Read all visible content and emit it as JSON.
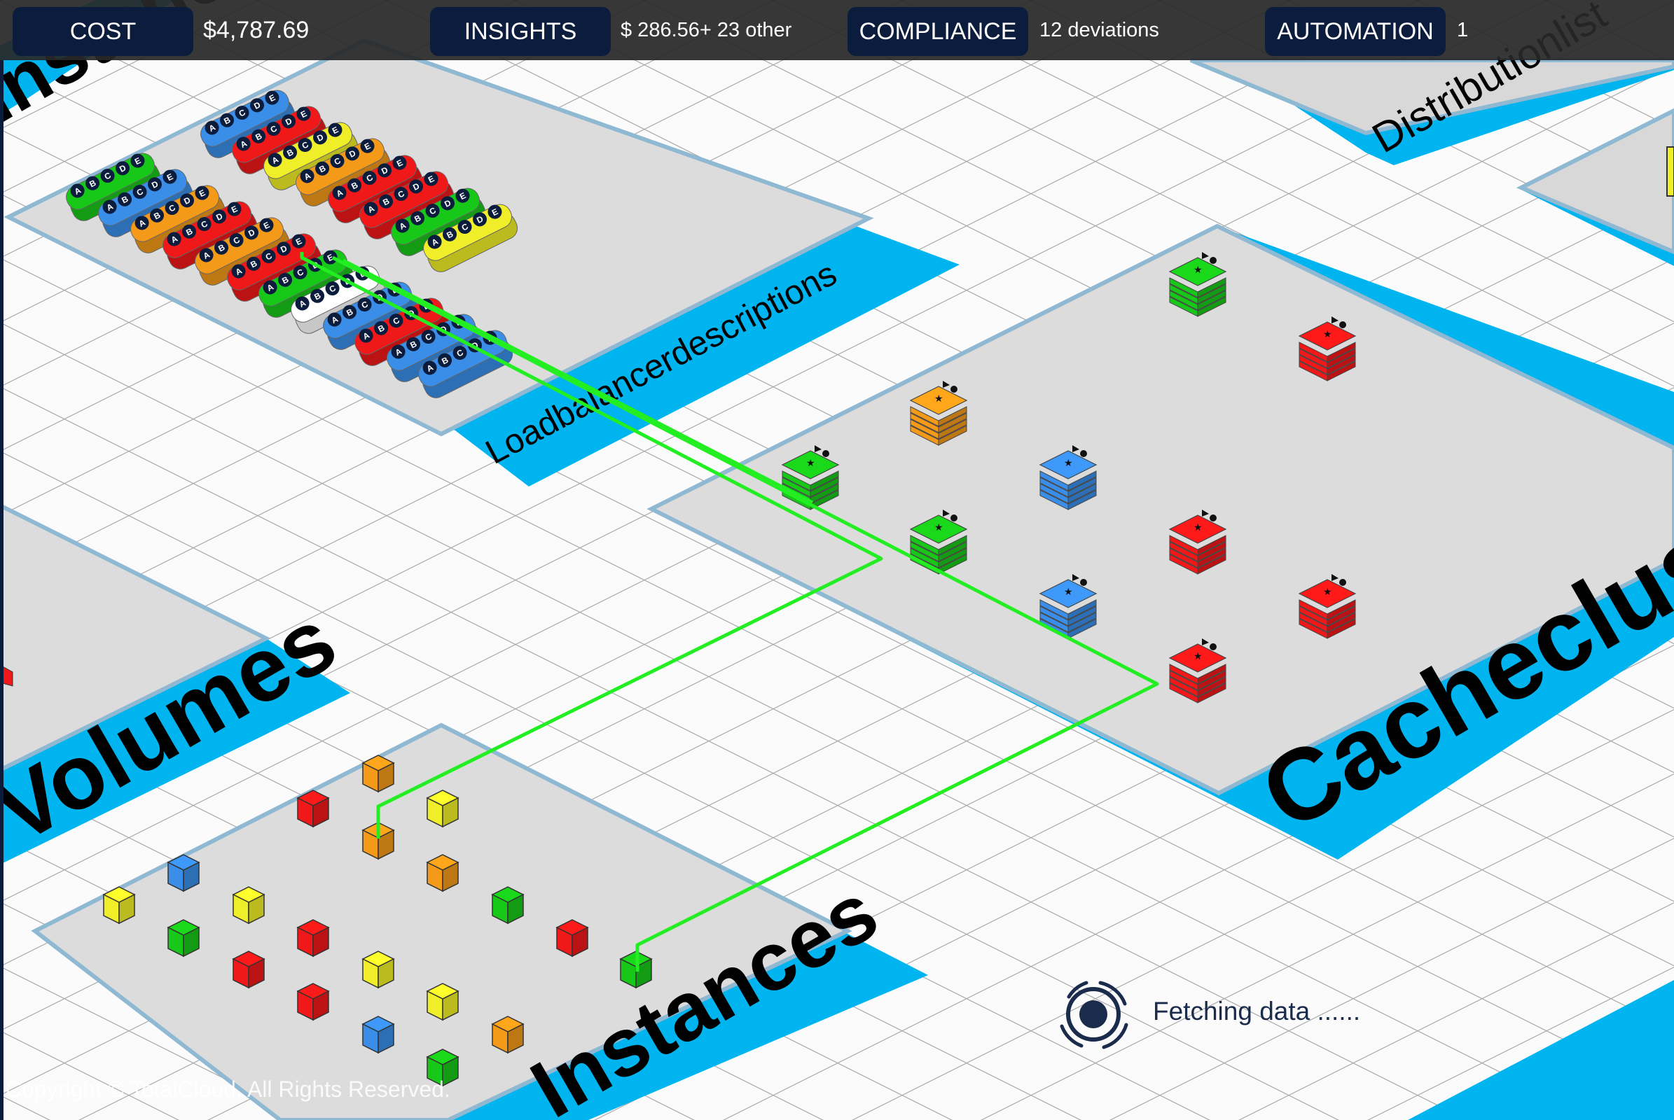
{
  "topbar": {
    "cost_label": "COST",
    "cost_value": "$4,787.69",
    "insights_label": "INSIGHTS",
    "insights_value": "$ 286.56+ 23 other",
    "compliance_label": "COMPLIANCE",
    "compliance_value": "12 deviations",
    "automation_label": "AUTOMATION",
    "automation_value": "1"
  },
  "zones": {
    "top_left": "Instances",
    "load_balancers": "Loadbalancerdescriptions",
    "distribution": "Distributionlist",
    "volumes": "Volumes",
    "cache": "Cacheclusters",
    "instances": "Instances"
  },
  "status": {
    "loading_text": "Fetching data ......"
  },
  "footer": {
    "copyright": "Copyright © TotalCloud. All Rights Reserved."
  },
  "colors": {
    "accent_blue": "#00b4f0",
    "navy": "#0b1c3d",
    "connection_green": "#22ee22",
    "red": "#f01818",
    "green": "#18c818",
    "blue": "#3a8ee8",
    "orange": "#f49a18",
    "yellow": "#f0ee28",
    "white": "#ffffff"
  },
  "lb_badge_letters": [
    "A",
    "B",
    "C",
    "D",
    "E"
  ],
  "cache_nodes": [
    {
      "color": "green"
    },
    {
      "color": "red"
    },
    {
      "color": "orange"
    },
    {
      "color": "blue"
    },
    {
      "color": "green"
    },
    {
      "color": "green"
    },
    {
      "color": "red"
    },
    {
      "color": "blue"
    },
    {
      "color": "red"
    },
    {
      "color": "red"
    }
  ],
  "instances": [
    {
      "color": "orange"
    },
    {
      "color": "red"
    },
    {
      "color": "yellow"
    },
    {
      "color": "orange"
    },
    {
      "color": "blue"
    },
    {
      "color": "orange"
    },
    {
      "color": "yellow"
    },
    {
      "color": "yellow"
    },
    {
      "color": "green"
    },
    {
      "color": "red"
    },
    {
      "color": "green"
    },
    {
      "color": "red"
    },
    {
      "color": "yellow"
    },
    {
      "color": "red"
    },
    {
      "color": "green"
    },
    {
      "color": "yellow"
    },
    {
      "color": "red"
    },
    {
      "color": "blue"
    },
    {
      "color": "orange"
    },
    {
      "color": "green"
    }
  ],
  "load_balancers": [
    {
      "color": "blue"
    },
    {
      "color": "red"
    },
    {
      "color": "yellow"
    },
    {
      "color": "orange"
    },
    {
      "color": "red"
    },
    {
      "color": "red"
    },
    {
      "color": "green"
    },
    {
      "color": "yellow"
    },
    {
      "color": "green"
    },
    {
      "color": "blue"
    },
    {
      "color": "orange"
    },
    {
      "color": "red"
    },
    {
      "color": "orange"
    },
    {
      "color": "red"
    },
    {
      "color": "green"
    },
    {
      "color": "white"
    },
    {
      "color": "blue"
    },
    {
      "color": "red"
    },
    {
      "color": "blue"
    },
    {
      "color": "blue"
    }
  ]
}
